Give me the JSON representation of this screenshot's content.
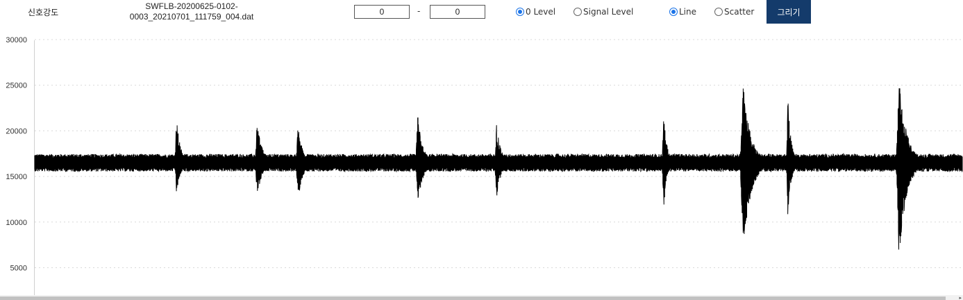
{
  "toolbar": {
    "title_label": "신호강도",
    "filename_line1": "SWFLB-20200625-0102-",
    "filename_line2": "0003_20210701_111759_004.dat",
    "range_start": "0",
    "range_separator": "-",
    "range_end": "0",
    "level_options": [
      {
        "label": "0 Level",
        "selected": true
      },
      {
        "label": "Signal Level",
        "selected": false
      }
    ],
    "plot_options": [
      {
        "label": "Line",
        "selected": true
      },
      {
        "label": "Scatter",
        "selected": false
      }
    ],
    "draw_button": "그리기"
  },
  "colors": {
    "signal": "#000000",
    "grid": "#d9d9d9",
    "axis_text": "#333333",
    "button_bg": "#143b6b"
  },
  "chart_data": {
    "type": "line",
    "title": "",
    "xlabel": "",
    "ylabel": "",
    "ylim": [
      2500,
      30000
    ],
    "yticks": [
      5000,
      10000,
      15000,
      20000,
      25000,
      30000
    ],
    "ytick_labels": [
      "5000",
      "10000",
      "15000",
      "20000",
      "25000",
      "30000"
    ],
    "grid": "horizontal dotted",
    "legend": "none",
    "series": [
      {
        "baseline": 16500,
        "noise_halfwidth": 950,
        "x_domain": [
          0,
          1
        ],
        "bursts": [
          {
            "x": 0.153,
            "max": 21200,
            "min": 13100,
            "width": 0.005
          },
          {
            "x": 0.24,
            "max": 21000,
            "min": 12700,
            "width": 0.006
          },
          {
            "x": 0.284,
            "max": 20400,
            "min": 12400,
            "width": 0.006
          },
          {
            "x": 0.413,
            "max": 21700,
            "min": 11500,
            "width": 0.006
          },
          {
            "x": 0.498,
            "max": 20800,
            "min": 12400,
            "width": 0.005
          },
          {
            "x": 0.678,
            "max": 21900,
            "min": 11200,
            "width": 0.004
          },
          {
            "x": 0.764,
            "max": 25000,
            "min": 6500,
            "width": 0.009
          },
          {
            "x": 0.812,
            "max": 23600,
            "min": 10300,
            "width": 0.004
          },
          {
            "x": 0.932,
            "max": 25700,
            "min": 6200,
            "width": 0.009
          }
        ]
      }
    ]
  }
}
